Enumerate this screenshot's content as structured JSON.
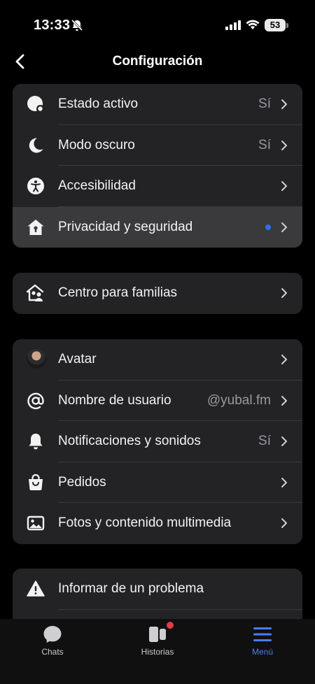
{
  "status": {
    "time": "13:33",
    "battery": "53"
  },
  "header": {
    "title": "Configuración"
  },
  "group1": [
    {
      "label": "Estado activo",
      "value": "Sí",
      "icon": "active-status-icon"
    },
    {
      "label": "Modo oscuro",
      "value": "Sí",
      "icon": "moon-icon"
    },
    {
      "label": "Accesibilidad",
      "value": "",
      "icon": "accessibility-icon"
    },
    {
      "label": "Privacidad y seguridad",
      "value": "",
      "icon": "house-lock-icon",
      "new_indicator": true
    }
  ],
  "group2": [
    {
      "label": "Centro para familias",
      "icon": "family-center-icon"
    }
  ],
  "group3": [
    {
      "label": "Avatar",
      "value": "",
      "icon": "avatar"
    },
    {
      "label": "Nombre de usuario",
      "value": "@yubal.fm",
      "icon": "at-icon"
    },
    {
      "label": "Notificaciones y sonidos",
      "value": "Sí",
      "icon": "bell-icon"
    },
    {
      "label": "Pedidos",
      "value": "",
      "icon": "shopping-bag-icon"
    },
    {
      "label": "Fotos y contenido multimedia",
      "value": "",
      "icon": "photo-icon"
    }
  ],
  "group4": [
    {
      "label": "Informar de un problema",
      "icon": "warning-icon"
    }
  ],
  "tabs": [
    {
      "label": "Chats",
      "icon": "chat-bubble-icon",
      "active": false
    },
    {
      "label": "Historias",
      "icon": "stories-icon",
      "active": false,
      "badge": true
    },
    {
      "label": "Menú",
      "icon": "menu-icon",
      "active": true
    }
  ],
  "colors": {
    "accent": "#4a7cf6",
    "background": "#000000",
    "card": "#232326",
    "badge": "#e83a45"
  }
}
